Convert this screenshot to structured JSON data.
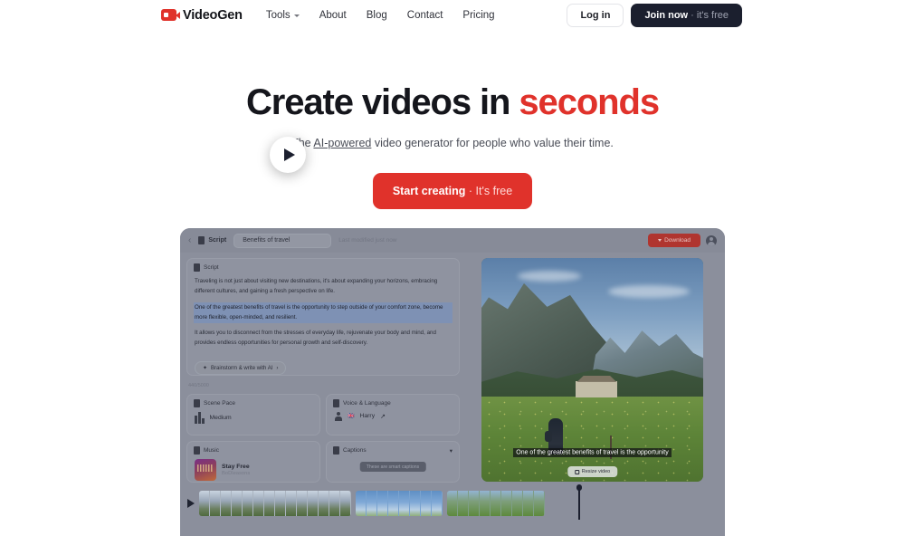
{
  "nav": {
    "brand": "VideoGen",
    "brand_logo_icon": "video-camera-icon",
    "links": [
      {
        "label": "Tools",
        "has_chevron": true
      },
      {
        "label": "About",
        "has_chevron": false
      },
      {
        "label": "Blog",
        "has_chevron": false
      },
      {
        "label": "Contact",
        "has_chevron": false
      },
      {
        "label": "Pricing",
        "has_chevron": false
      }
    ],
    "login_label": "Log in",
    "join_label": "Join now",
    "join_suffix": " · it's free"
  },
  "hero": {
    "headline_main": "Create videos in ",
    "headline_accent": "seconds",
    "sub_before": "The ",
    "sub_link": "AI-powered",
    "sub_after": " video generator for people who value their time.",
    "cta_label": "Start creating",
    "cta_suffix": " · It's free"
  },
  "app": {
    "toolbar": {
      "back_icon": "chevron-left-icon",
      "doc_icon": "file-icon",
      "doc_label": "Script",
      "project_title": "Benefits of travel",
      "modified": "Last modified just now",
      "download_label": "Download",
      "avatar_icon": "user-avatar"
    },
    "script_card": {
      "header_icon": "file-icon",
      "header_label": "Script",
      "paragraphs": [
        {
          "text": "Traveling is not just about visiting new destinations, it's about expanding your horizons, embracing different cultures, and gaining a fresh perspective on life.",
          "highlighted": false
        },
        {
          "text": "One of the greatest benefits of travel is the opportunity to step outside of your comfort zone, become more flexible, open-minded, and resilient.",
          "highlighted": true
        },
        {
          "text": "It allows you to disconnect from the stresses of everyday life, rejuvenate your body and mind, and provides endless opportunities for personal growth and self-discovery.",
          "highlighted": false
        }
      ],
      "ai_chip_label": "Brainstorm & write with AI",
      "ai_chip_icon": "sparkle-icon",
      "char_count": "440/5000"
    },
    "scene_pace_card": {
      "header_icon": "frames-icon",
      "header_label": "Scene Pace",
      "value": "Medium"
    },
    "voice_card": {
      "header_icon": "microphone-icon",
      "header_label": "Voice & Language",
      "voice_name": "Harry",
      "flag_icon": "flag-gb-icon"
    },
    "music_card": {
      "header_icon": "music-note-icon",
      "header_label": "Music",
      "track_name": "Stay Free",
      "track_artist": "BoDleasons"
    },
    "captions_card": {
      "header_icon": "caption-icon",
      "header_label": "Captions",
      "toggle_icon": "toggle-icon",
      "preview_text": "These are smart captions"
    },
    "preview": {
      "caption_overlay": "One of the greatest benefits of travel is the opportunity",
      "resize_label": "Resize video",
      "resize_icon": "resize-icon",
      "play_icon": "play-icon"
    },
    "timeline": {
      "play_icon": "play-icon",
      "clips": [
        {
          "name": "clip-1",
          "frames": 14
        },
        {
          "name": "clip-2",
          "frames": 8
        },
        {
          "name": "clip-3",
          "frames": 9
        }
      ]
    }
  },
  "colors": {
    "accent_red": "#e0322b",
    "dark_navy": "#1b1f2e",
    "text_dark": "#15161c"
  }
}
